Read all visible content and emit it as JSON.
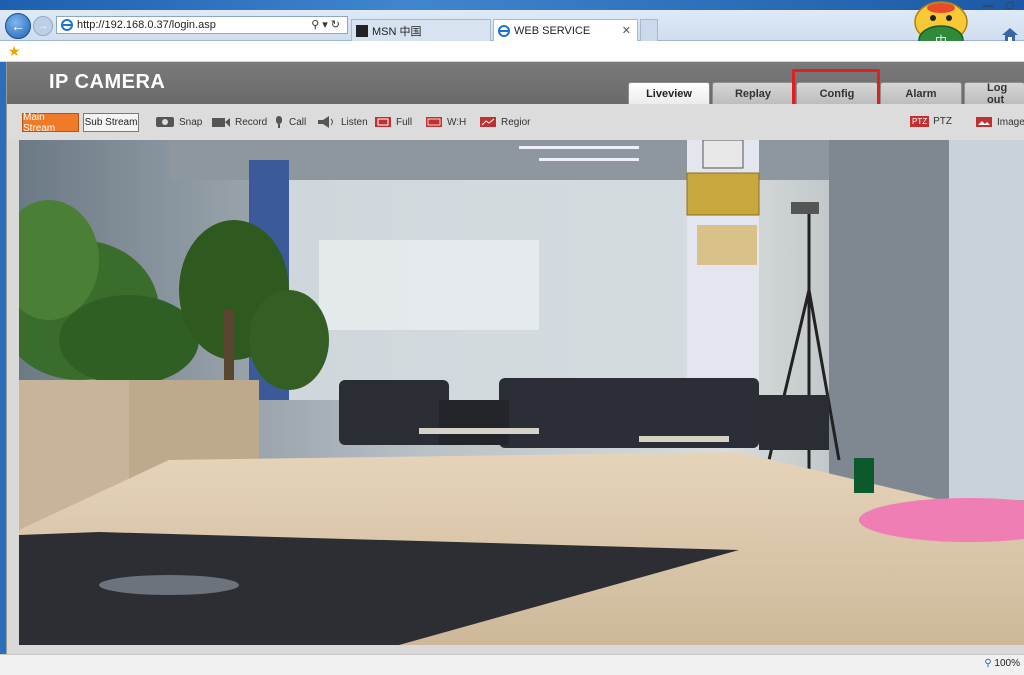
{
  "browser": {
    "url": "http://192.168.0.37/login.asp",
    "tabs": [
      {
        "label": "MSN 中国"
      },
      {
        "label": "WEB SERVICE"
      }
    ],
    "mascot_text": "中",
    "zoom": "100%"
  },
  "camera": {
    "title": "IP CAMERA",
    "main_tabs": [
      "Liveview",
      "Replay",
      "Config",
      "Alarm",
      "Log out"
    ],
    "active_tab": "Liveview",
    "highlighted_tab": "Config",
    "streams": {
      "main": "Main Stream",
      "sub": "Sub Stream"
    },
    "tools": {
      "snap": "Snap",
      "record": "Record",
      "call": "Call",
      "listen": "Listen",
      "full": "Full",
      "wh": "W:H",
      "region": "Regior",
      "ptz_icon": "PTZ",
      "ptz": "PTZ",
      "images": "Images"
    }
  },
  "colors": {
    "main_stream": "#f07a28",
    "highlight_box": "#e02020",
    "header": "#707070"
  },
  "icons": [
    "back-arrow-icon",
    "forward-arrow-icon",
    "ie-icon",
    "search-icon",
    "refresh-icon",
    "close-icon",
    "home-icon",
    "favorites-star-icon",
    "camera-icon",
    "record-icon",
    "microphone-icon",
    "speaker-icon",
    "fullscreen-icon",
    "aspect-ratio-icon",
    "region-icon",
    "ptz-icon",
    "image-icon",
    "magnifier-icon"
  ]
}
